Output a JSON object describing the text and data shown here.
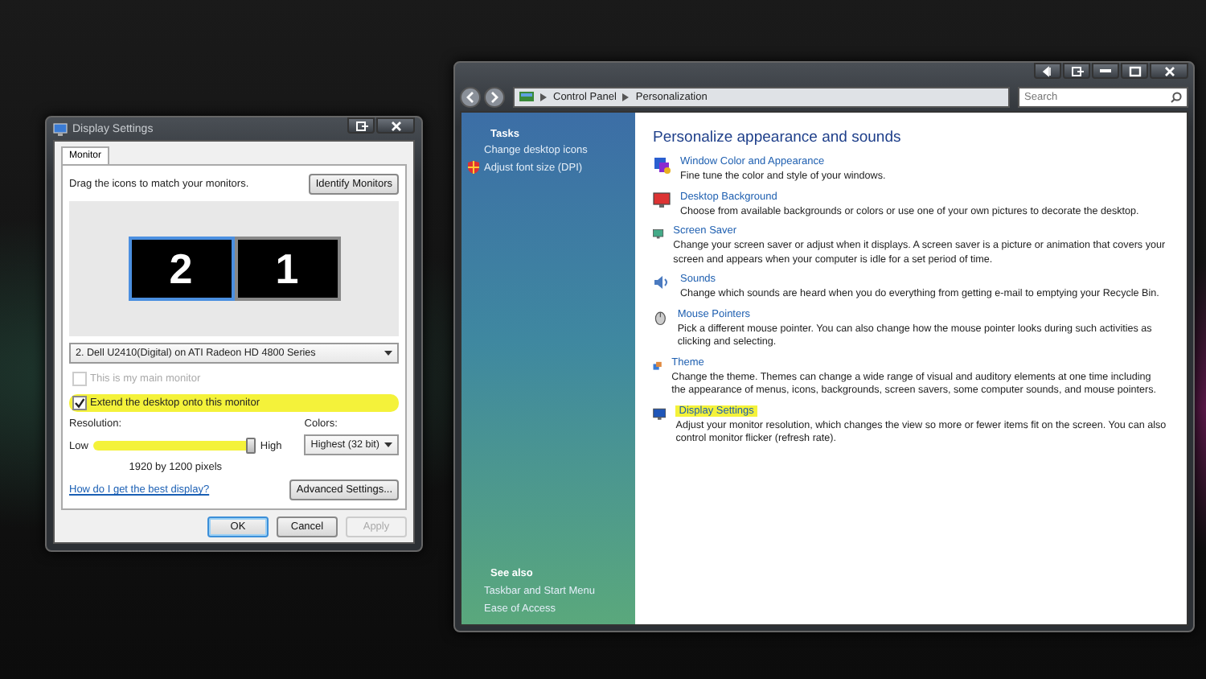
{
  "display_settings": {
    "title": "Display Settings",
    "tabs": [
      {
        "label": "Monitor",
        "selected": true
      }
    ],
    "instruction": "Drag the icons to match your monitors.",
    "identify_button": "Identify Monitors",
    "monitors": [
      {
        "label": "2",
        "selected": true
      },
      {
        "label": "1",
        "selected": false
      }
    ],
    "monitor_select": "2. Dell U2410(Digital) on ATI Radeon HD 4800 Series",
    "options": [
      {
        "label": "This is my main monitor",
        "checked": false,
        "disabled": true,
        "highlighted": false
      },
      {
        "label": "Extend the desktop onto this monitor",
        "checked": true,
        "disabled": false,
        "highlighted": true
      }
    ],
    "resolution": {
      "label": "Resolution:",
      "low": "Low",
      "high": "High",
      "level": 1,
      "highlighted": true,
      "reading": "1920 by 1200 pixels"
    },
    "colors": {
      "label": "Colors:",
      "value": "Highest (32 bit)"
    },
    "help_link": "How do I get the best display?",
    "advanced_button": "Advanced Settings...",
    "buttons": [
      {
        "label": "OK",
        "default": true,
        "disabled": false
      },
      {
        "label": "Cancel",
        "default": false,
        "disabled": false
      },
      {
        "label": "Apply",
        "default": false,
        "disabled": true
      }
    ]
  },
  "control_panel": {
    "breadcrumb": [
      "Control Panel",
      "Personalization"
    ],
    "search": {
      "placeholder": "Search"
    },
    "sidebar": {
      "tasks_heading": "Tasks",
      "tasks": [
        {
          "label": "Change desktop icons",
          "kind": "plain"
        },
        {
          "label": "Adjust font size (DPI)",
          "kind": "shield"
        }
      ],
      "see_also_heading": "See also",
      "see_also": [
        "Taskbar and Start Menu",
        "Ease of Access"
      ]
    },
    "heading": "Personalize appearance and sounds",
    "items": [
      {
        "kind": "color",
        "title": "Window Color and Appearance",
        "description": "Fine tune the color and style of your windows.",
        "highlighted": false
      },
      {
        "kind": "background",
        "title": "Desktop Background",
        "description": "Choose from available backgrounds or colors or use one of your own pictures to decorate the desktop.",
        "highlighted": false
      },
      {
        "kind": "screensaver",
        "title": "Screen Saver",
        "description": "Change your screen saver or adjust when it displays. A screen saver is a picture or animation that covers your screen and appears when your computer is idle for a set period of time.",
        "highlighted": false
      },
      {
        "kind": "sounds",
        "title": "Sounds",
        "description": "Change which sounds are heard when you do everything from getting e-mail to emptying your Recycle Bin.",
        "highlighted": false
      },
      {
        "kind": "mouse",
        "title": "Mouse Pointers",
        "description": "Pick a different mouse pointer. You can also change how the mouse pointer looks during such activities as clicking and selecting.",
        "highlighted": false
      },
      {
        "kind": "theme",
        "title": "Theme",
        "description": "Change the theme. Themes can change a wide range of visual and auditory elements at one time including the appearance of menus, icons, backgrounds, screen savers, some computer sounds, and mouse pointers.",
        "highlighted": false
      },
      {
        "kind": "display",
        "title": "Display Settings",
        "description": "Adjust your monitor resolution, which changes the view so more or fewer items fit on the screen. You can also control monitor flicker (refresh rate).",
        "highlighted": true
      }
    ]
  }
}
